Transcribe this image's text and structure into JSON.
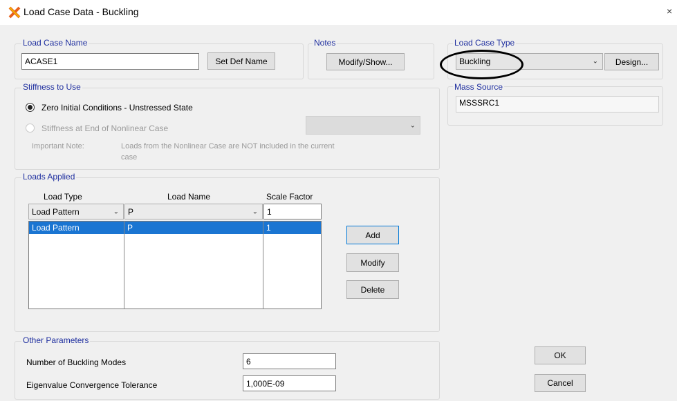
{
  "window": {
    "title": "Load Case Data - Buckling",
    "close_glyph": "×"
  },
  "load_case_name": {
    "title": "Load Case Name",
    "value": "ACASE1",
    "set_def_name_label": "Set Def Name"
  },
  "notes": {
    "title": "Notes",
    "modify_show_label": "Modify/Show..."
  },
  "load_case_type": {
    "title": "Load Case Type",
    "selected": "Buckling",
    "design_label": "Design..."
  },
  "mass_source": {
    "title": "Mass Source",
    "value": "MSSSRC1"
  },
  "stiffness": {
    "title": "Stiffness to Use",
    "option_zero": "Zero Initial Conditions - Unstressed State",
    "option_nonlinear": "Stiffness at End of Nonlinear Case",
    "note_label": "Important Note:",
    "note_text_line1": "Loads from the Nonlinear Case are NOT included in the current",
    "note_text_line2": "case",
    "selected": "zero"
  },
  "loads_applied": {
    "title": "Loads Applied",
    "headers": {
      "load_type": "Load Type",
      "load_name": "Load Name",
      "scale_factor": "Scale Factor"
    },
    "edit_row": {
      "load_type": "Load Pattern",
      "load_name": "P",
      "scale_factor": "1"
    },
    "rows": [
      {
        "load_type": "Load Pattern",
        "load_name": "P",
        "scale_factor": "1"
      }
    ],
    "add_label": "Add",
    "modify_label": "Modify",
    "delete_label": "Delete"
  },
  "other_parameters": {
    "title": "Other Parameters",
    "buckling_modes_label": "Number of Buckling Modes",
    "buckling_modes_value": "6",
    "tolerance_label": "Eigenvalue Convergence Tolerance",
    "tolerance_value": "1,000E-09"
  },
  "footer": {
    "ok_label": "OK",
    "cancel_label": "Cancel"
  },
  "colors": {
    "group_title": "#1f2f9f",
    "selection": "#1a75d2",
    "annotation": "#000000"
  },
  "icons": [
    "app-icon",
    "close-icon",
    "chevron-down-icon"
  ]
}
